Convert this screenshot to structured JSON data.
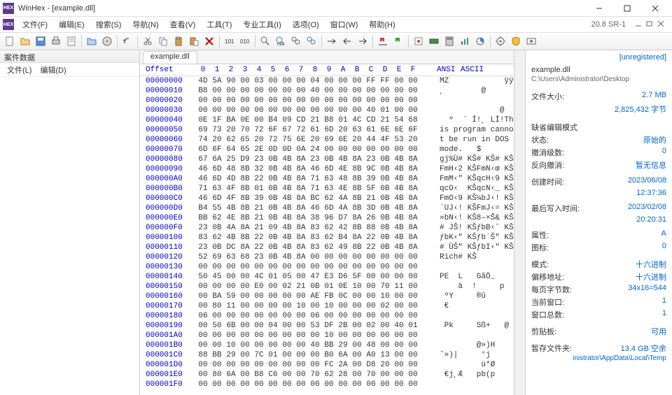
{
  "window": {
    "title": "WinHex - [example.dll]",
    "version": "20.8 SR-1"
  },
  "menus": [
    "文件(F)",
    "编辑(E)",
    "搜索(S)",
    "导航(N)",
    "查看(V)",
    "工具(T)",
    "专业工具(I)",
    "选项(O)",
    "窗口(W)",
    "帮助(H)"
  ],
  "left_panel": {
    "title": "案件数据",
    "menu": [
      "文件(L)",
      "编辑(D)"
    ]
  },
  "tab": "example.dll",
  "hex": {
    "offset_label": "Offset",
    "ascii_header": [
      "ANSI",
      "ASCII"
    ],
    "cols": [
      "0",
      "1",
      "2",
      "3",
      "4",
      "5",
      "6",
      "7",
      "8",
      "9",
      "A",
      "B",
      "C",
      "D",
      "E",
      "F"
    ],
    "rows": [
      {
        "o": "00000000",
        "b": [
          "4D",
          "5A",
          "90",
          "00",
          "03",
          "00",
          "00",
          "00",
          "04",
          "00",
          "00",
          "00",
          "FF",
          "FF",
          "00",
          "00"
        ],
        "a": "MZ            ÿÿ"
      },
      {
        "o": "00000010",
        "b": [
          "B8",
          "00",
          "00",
          "00",
          "00",
          "00",
          "00",
          "00",
          "40",
          "00",
          "00",
          "00",
          "00",
          "00",
          "00",
          "00"
        ],
        "a": "¸        @"
      },
      {
        "o": "00000020",
        "b": [
          "00",
          "00",
          "00",
          "00",
          "00",
          "00",
          "00",
          "00",
          "00",
          "00",
          "00",
          "00",
          "00",
          "00",
          "00",
          "00"
        ],
        "a": ""
      },
      {
        "o": "00000030",
        "b": [
          "00",
          "00",
          "00",
          "00",
          "00",
          "00",
          "00",
          "00",
          "00",
          "00",
          "00",
          "00",
          "40",
          "01",
          "00",
          "00"
        ],
        "a": "             @"
      },
      {
        "o": "00000040",
        "b": [
          "0E",
          "1F",
          "BA",
          "0E",
          "00",
          "B4",
          "09",
          "CD",
          "21",
          "B8",
          "01",
          "4C",
          "CD",
          "21",
          "54",
          "68"
        ],
        "a": "  º  ´ Í!¸ LÍ!Th"
      },
      {
        "o": "00000050",
        "b": [
          "69",
          "73",
          "20",
          "70",
          "72",
          "6F",
          "67",
          "72",
          "61",
          "6D",
          "20",
          "63",
          "61",
          "6E",
          "6E",
          "6F"
        ],
        "a": "is program canno"
      },
      {
        "o": "00000060",
        "b": [
          "74",
          "20",
          "62",
          "65",
          "20",
          "72",
          "75",
          "6E",
          "20",
          "69",
          "6E",
          "20",
          "44",
          "4F",
          "53",
          "20"
        ],
        "a": "t be run in DOS "
      },
      {
        "o": "00000070",
        "b": [
          "6D",
          "6F",
          "64",
          "65",
          "2E",
          "0D",
          "0D",
          "0A",
          "24",
          "00",
          "00",
          "00",
          "00",
          "00",
          "00",
          "00"
        ],
        "a": "mode.   $"
      },
      {
        "o": "00000080",
        "b": [
          "67",
          "6A",
          "25",
          "D9",
          "23",
          "0B",
          "4B",
          "8A",
          "23",
          "0B",
          "4B",
          "8A",
          "23",
          "0B",
          "4B",
          "8A"
        ],
        "a": "gj%Ù# KŠ# KŠ# KŠ"
      },
      {
        "o": "00000090",
        "b": [
          "46",
          "6D",
          "48",
          "8B",
          "32",
          "0B",
          "4B",
          "8A",
          "46",
          "6D",
          "4E",
          "8B",
          "9C",
          "0B",
          "4B",
          "8A"
        ],
        "a": "FmH‹2 KŠFmN‹œ KŠ"
      },
      {
        "o": "000000A0",
        "b": [
          "46",
          "6D",
          "4D",
          "8B",
          "22",
          "0B",
          "4B",
          "8A",
          "71",
          "63",
          "48",
          "8B",
          "39",
          "0B",
          "4B",
          "8A"
        ],
        "a": "FmM‹\" KŠqcH‹9 KŠ"
      },
      {
        "o": "000000B0",
        "b": [
          "71",
          "63",
          "4F",
          "8B",
          "01",
          "0B",
          "4B",
          "8A",
          "71",
          "63",
          "4E",
          "8B",
          "5F",
          "0B",
          "4B",
          "8A"
        ],
        "a": "qcO‹  KŠqcN‹_ KŠ"
      },
      {
        "o": "000000C0",
        "b": [
          "46",
          "6D",
          "4F",
          "8B",
          "39",
          "0B",
          "4B",
          "8A",
          "BC",
          "62",
          "4A",
          "8B",
          "21",
          "0B",
          "4B",
          "8A"
        ],
        "a": "FmO‹9 KŠ¼bJ‹! KŠ"
      },
      {
        "o": "000000D0",
        "b": [
          "B4",
          "55",
          "4B",
          "8B",
          "21",
          "0B",
          "4B",
          "8A",
          "46",
          "6D",
          "4A",
          "8B",
          "3D",
          "0B",
          "4B",
          "8A"
        ],
        "a": "´UJ‹! KŠFmJ‹= KŠ"
      },
      {
        "o": "000000E0",
        "b": [
          "BB",
          "62",
          "4E",
          "8B",
          "21",
          "0B",
          "4B",
          "8A",
          "38",
          "96",
          "D7",
          "8A",
          "26",
          "0B",
          "4B",
          "8A"
        ],
        "a": "»bN‹! KŠ8–×Š& KŠ"
      },
      {
        "o": "000000F0",
        "b": [
          "23",
          "0B",
          "4A",
          "8A",
          "21",
          "09",
          "4B",
          "8A",
          "83",
          "62",
          "42",
          "8B",
          "88",
          "0B",
          "4B",
          "8A"
        ],
        "a": "# JŠ! KŠƒbB‹ˆ KŠ"
      },
      {
        "o": "00000100",
        "b": [
          "83",
          "62",
          "4B",
          "8B",
          "22",
          "0B",
          "4B",
          "8A",
          "83",
          "62",
          "B4",
          "8A",
          "22",
          "0B",
          "4B",
          "8A"
        ],
        "a": "ƒbK‹\" KŠƒb´Š\" KŠ"
      },
      {
        "o": "00000110",
        "b": [
          "23",
          "0B",
          "DC",
          "8A",
          "22",
          "0B",
          "4B",
          "8A",
          "83",
          "62",
          "49",
          "8B",
          "22",
          "0B",
          "4B",
          "8A"
        ],
        "a": "# ÜŠ\" KŠƒbI‹\" KŠ"
      },
      {
        "o": "00000120",
        "b": [
          "52",
          "69",
          "63",
          "68",
          "23",
          "0B",
          "4B",
          "8A",
          "00",
          "00",
          "00",
          "00",
          "00",
          "00",
          "00",
          "00"
        ],
        "a": "Rich# KŠ"
      },
      {
        "o": "00000130",
        "b": [
          "00",
          "00",
          "00",
          "00",
          "00",
          "00",
          "00",
          "00",
          "00",
          "00",
          "00",
          "00",
          "00",
          "00",
          "00",
          "00"
        ],
        "a": ""
      },
      {
        "o": "00000140",
        "b": [
          "50",
          "45",
          "00",
          "00",
          "4C",
          "01",
          "05",
          "00",
          "47",
          "E3",
          "D6",
          "5F",
          "00",
          "00",
          "00",
          "00"
        ],
        "a": "PE  L   GãÖ_"
      },
      {
        "o": "00000150",
        "b": [
          "00",
          "00",
          "00",
          "00",
          "E0",
          "00",
          "02",
          "21",
          "0B",
          "01",
          "0E",
          "10",
          "00",
          "70",
          "11",
          "00"
        ],
        "a": "    à  !     p"
      },
      {
        "o": "00000160",
        "b": [
          "00",
          "BA",
          "59",
          "00",
          "00",
          "00",
          "00",
          "00",
          "AE",
          "FB",
          "0C",
          "00",
          "00",
          "10",
          "00",
          "00"
        ],
        "a": " ºY     ®û"
      },
      {
        "o": "00000170",
        "b": [
          "00",
          "80",
          "11",
          "00",
          "00",
          "00",
          "00",
          "10",
          "00",
          "10",
          "00",
          "00",
          "00",
          "02",
          "00",
          "00"
        ],
        "a": " €"
      },
      {
        "o": "00000180",
        "b": [
          "06",
          "00",
          "00",
          "00",
          "00",
          "00",
          "00",
          "00",
          "06",
          "00",
          "00",
          "00",
          "00",
          "00",
          "00",
          "00"
        ],
        "a": ""
      },
      {
        "o": "00000190",
        "b": [
          "00",
          "50",
          "6B",
          "00",
          "00",
          "04",
          "00",
          "00",
          "53",
          "DF",
          "2B",
          "00",
          "02",
          "00",
          "40",
          "01"
        ],
        "a": " Pk     Sß+   @"
      },
      {
        "o": "000001A0",
        "b": [
          "00",
          "00",
          "00",
          "00",
          "00",
          "00",
          "00",
          "00",
          "00",
          "10",
          "00",
          "00",
          "00",
          "00",
          "00",
          "00"
        ],
        "a": ""
      },
      {
        "o": "000001B0",
        "b": [
          "00",
          "00",
          "10",
          "00",
          "00",
          "00",
          "00",
          "00",
          "40",
          "BB",
          "29",
          "00",
          "48",
          "00",
          "00",
          "00"
        ],
        "a": "        @»)H"
      },
      {
        "o": "000001C0",
        "b": [
          "88",
          "BB",
          "29",
          "00",
          "7C",
          "01",
          "00",
          "00",
          "00",
          "B0",
          "6A",
          "00",
          "A0",
          "13",
          "00",
          "00"
        ],
        "a": "ˆ»)|     °j  "
      },
      {
        "o": "000001D0",
        "b": [
          "00",
          "00",
          "00",
          "00",
          "00",
          "00",
          "00",
          "00",
          "00",
          "FC",
          "2A",
          "00",
          "D8",
          "20",
          "00",
          "00"
        ],
        "a": "         ü*Ø"
      },
      {
        "o": "000001E0",
        "b": [
          "00",
          "80",
          "6A",
          "00",
          "B8",
          "C6",
          "00",
          "00",
          "70",
          "62",
          "28",
          "00",
          "70",
          "00",
          "00",
          "00"
        ],
        "a": " €j¸Æ   pb(p"
      },
      {
        "o": "000001F0",
        "b": [
          "00",
          "00",
          "00",
          "00",
          "00",
          "00",
          "00",
          "00",
          "00",
          "00",
          "00",
          "00",
          "00",
          "00",
          "00",
          "00"
        ],
        "a": ""
      }
    ]
  },
  "right": {
    "unregistered": "[unregistered]",
    "filename": "example.dll",
    "path": "C:\\Users\\Administrator\\Desktop",
    "filesize_label": "文件大小:",
    "filesize_val": "2.7 MB",
    "filesize_bytes": "2,825,432 字节",
    "editmode_label": "缺省编辑模式",
    "state_label": "状态:",
    "state_val": "原始的",
    "undo_label": "撤消级数:",
    "undo_val": "0",
    "revundo_label": "反向撤消:",
    "revundo_val": "暂无信息",
    "ctime_label": "创建时间:",
    "ctime_val": "2023/06/08",
    "ctime_time": "12:37:36",
    "mtime_label": "最后写入时间:",
    "mtime_val": "2023/02/08",
    "mtime_time": "20:20:31",
    "attr_label": "属性:",
    "attr_val": "A",
    "icon_label": "图标:",
    "icon_val": "0",
    "mode_label": "模式:",
    "mode_val": "十六进制",
    "offaddr_label": "偏移地址:",
    "offaddr_val": "十六进制",
    "bpp_label": "每页字节数:",
    "bpp_val": "34x16=544",
    "curwin_label": "当前窗口:",
    "curwin_val": "1",
    "totwin_label": "窗口总数:",
    "totwin_val": "1",
    "clip_label": "剪贴板:",
    "clip_val": "可用",
    "temp_label": "暂存文件夹:",
    "temp_val": "13.4 GB 空余",
    "temp_path": "inistrator\\AppData\\Local\\Temp"
  }
}
